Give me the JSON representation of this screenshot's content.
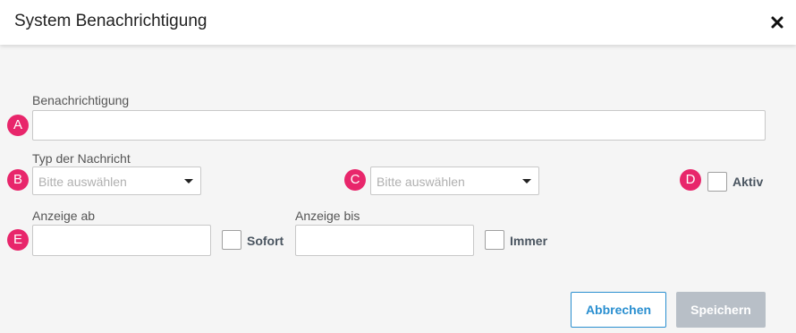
{
  "dialog": {
    "title": "System Benachrichtigung",
    "close_icon": "close-icon"
  },
  "form": {
    "message_label": "Benachrichtigung",
    "message_value": "",
    "type_label": "Typ der Nachricht",
    "type_select_placeholder": "Bitte auswählen",
    "second_select_placeholder": "Bitte auswählen",
    "active_label": "Aktiv",
    "active_checked": false,
    "show_from_label": "Anzeige ab",
    "show_from_value": "",
    "immediately_label": "Sofort",
    "immediately_checked": false,
    "show_until_label": "Anzeige bis",
    "show_until_value": "",
    "always_label": "Immer",
    "always_checked": false
  },
  "badges": [
    "A",
    "B",
    "C",
    "D",
    "E"
  ],
  "buttons": {
    "cancel_label": "Abbrechen",
    "save_label": "Speichern"
  },
  "colors": {
    "badge": "#e8266b",
    "primary": "#2a8fd0",
    "disabled": "#b8bfc7"
  }
}
